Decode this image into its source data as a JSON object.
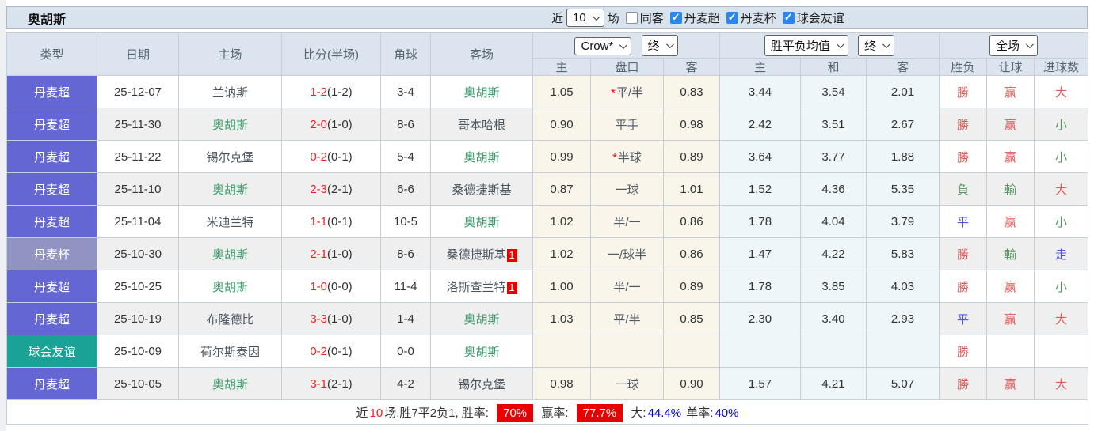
{
  "title": "奥胡斯",
  "controls": {
    "recent_label": "近",
    "match_count": "10",
    "matches_label": "场",
    "checkboxes": [
      {
        "label": "同客",
        "checked": false
      },
      {
        "label": "丹麦超",
        "checked": true
      },
      {
        "label": "丹麦杯",
        "checked": true
      },
      {
        "label": "球会友谊",
        "checked": true
      }
    ]
  },
  "header": {
    "left_cols": [
      "类型",
      "日期",
      "主场",
      "比分(半场)",
      "角球",
      "客场"
    ],
    "odds_provider_select": "Crow*",
    "odds_final_select": "终",
    "europe_select": "胜平负均值",
    "europe_final_select": "终",
    "scope_select": "全场",
    "sub_cols": [
      "主",
      "盘口",
      "客",
      "主",
      "和",
      "客",
      "胜负",
      "让球",
      "进球数"
    ]
  },
  "rows": [
    {
      "type": "丹麦超",
      "league": "super",
      "date": "25-12-07",
      "home": "兰讷斯",
      "home_green": false,
      "home_badge": "",
      "score": "1-2",
      "half": "(1-2)",
      "corners": "3-4",
      "away": "奥胡斯",
      "away_green": true,
      "away_badge": "",
      "h1": "1.05",
      "hk": "平/半",
      "star": true,
      "h2": "0.83",
      "e1": "3.44",
      "e2": "3.54",
      "e3": "2.01",
      "r1": "勝",
      "c1": "red",
      "r2": "赢",
      "c2": "red",
      "r3": "大",
      "c3": "red"
    },
    {
      "type": "丹麦超",
      "league": "super",
      "date": "25-11-30",
      "home": "奥胡斯",
      "home_green": true,
      "home_badge": "",
      "score": "2-0",
      "half": "(1-0)",
      "corners": "8-6",
      "away": "哥本哈根",
      "away_green": false,
      "away_badge": "",
      "h1": "0.90",
      "hk": "平手",
      "star": false,
      "h2": "0.98",
      "e1": "2.42",
      "e2": "3.51",
      "e3": "2.67",
      "r1": "勝",
      "c1": "red",
      "r2": "赢",
      "c2": "red",
      "r3": "小",
      "c3": "green"
    },
    {
      "type": "丹麦超",
      "league": "super",
      "date": "25-11-22",
      "home": "锡尔克堡",
      "home_green": false,
      "home_badge": "",
      "score": "0-2",
      "half": "(0-1)",
      "corners": "5-4",
      "away": "奥胡斯",
      "away_green": true,
      "away_badge": "",
      "h1": "0.99",
      "hk": "半球",
      "star": true,
      "h2": "0.89",
      "e1": "3.64",
      "e2": "3.77",
      "e3": "1.88",
      "r1": "勝",
      "c1": "red",
      "r2": "赢",
      "c2": "red",
      "r3": "小",
      "c3": "green"
    },
    {
      "type": "丹麦超",
      "league": "super",
      "date": "25-11-10",
      "home": "奥胡斯",
      "home_green": true,
      "home_badge": "",
      "score": "2-3",
      "half": "(2-1)",
      "corners": "6-6",
      "away": "桑德捷斯基",
      "away_green": false,
      "away_badge": "",
      "h1": "0.87",
      "hk": "一球",
      "star": false,
      "h2": "1.01",
      "e1": "1.52",
      "e2": "4.36",
      "e3": "5.35",
      "r1": "負",
      "c1": "green",
      "r2": "輸",
      "c2": "green",
      "r3": "大",
      "c3": "red"
    },
    {
      "type": "丹麦超",
      "league": "super",
      "date": "25-11-04",
      "home": "米迪兰特",
      "home_green": false,
      "home_badge": "",
      "score": "1-1",
      "half": "(0-1)",
      "corners": "10-5",
      "away": "奥胡斯",
      "away_green": true,
      "away_badge": "",
      "h1": "1.02",
      "hk": "半/一",
      "star": false,
      "h2": "0.86",
      "e1": "1.78",
      "e2": "4.04",
      "e3": "3.79",
      "r1": "平",
      "c1": "blue",
      "r2": "赢",
      "c2": "red",
      "r3": "小",
      "c3": "green"
    },
    {
      "type": "丹麦杯",
      "league": "cup",
      "date": "25-10-30",
      "home": "奥胡斯",
      "home_green": true,
      "home_badge": "",
      "score": "2-1",
      "half": "(1-0)",
      "corners": "8-6",
      "away": "桑德捷斯基",
      "away_green": false,
      "away_badge": "1",
      "h1": "1.02",
      "hk": "一/球半",
      "star": false,
      "h2": "0.86",
      "e1": "1.47",
      "e2": "4.22",
      "e3": "5.83",
      "r1": "勝",
      "c1": "red",
      "r2": "輸",
      "c2": "green",
      "r3": "走",
      "c3": "blue"
    },
    {
      "type": "丹麦超",
      "league": "super",
      "date": "25-10-25",
      "home": "奥胡斯",
      "home_green": true,
      "home_badge": "",
      "score": "1-0",
      "half": "(0-0)",
      "corners": "11-4",
      "away": "洛斯查兰特",
      "away_green": false,
      "away_badge": "1",
      "h1": "1.00",
      "hk": "半/一",
      "star": false,
      "h2": "0.89",
      "e1": "1.78",
      "e2": "3.85",
      "e3": "4.03",
      "r1": "勝",
      "c1": "red",
      "r2": "赢",
      "c2": "red",
      "r3": "小",
      "c3": "green"
    },
    {
      "type": "丹麦超",
      "league": "super",
      "date": "25-10-19",
      "home": "布隆德比",
      "home_green": false,
      "home_badge": "",
      "score": "3-3",
      "half": "(1-0)",
      "corners": "1-4",
      "away": "奥胡斯",
      "away_green": true,
      "away_badge": "",
      "h1": "1.03",
      "hk": "平/半",
      "star": false,
      "h2": "0.85",
      "e1": "2.30",
      "e2": "3.40",
      "e3": "2.93",
      "r1": "平",
      "c1": "blue",
      "r2": "赢",
      "c2": "red",
      "r3": "大",
      "c3": "red"
    },
    {
      "type": "球会友谊",
      "league": "friendly",
      "date": "25-10-09",
      "home": "荷尔斯泰因",
      "home_green": false,
      "home_badge": "",
      "score": "0-2",
      "half": "(0-1)",
      "corners": "0-0",
      "away": "奥胡斯",
      "away_green": true,
      "away_badge": "",
      "h1": "",
      "hk": "",
      "star": false,
      "h2": "",
      "e1": "",
      "e2": "",
      "e3": "",
      "r1": "勝",
      "c1": "red",
      "r2": "",
      "c2": "",
      "r3": "",
      "c3": ""
    },
    {
      "type": "丹麦超",
      "league": "super",
      "date": "25-10-05",
      "home": "奥胡斯",
      "home_green": true,
      "home_badge": "",
      "score": "3-1",
      "half": "(2-1)",
      "corners": "4-2",
      "away": "锡尔克堡",
      "away_green": false,
      "away_badge": "",
      "h1": "0.98",
      "hk": "一球",
      "star": false,
      "h2": "0.90",
      "e1": "1.57",
      "e2": "4.21",
      "e3": "5.07",
      "r1": "勝",
      "c1": "red",
      "r2": "赢",
      "c2": "red",
      "r3": "大",
      "c3": "red"
    }
  ],
  "footer": {
    "recent_label": "近",
    "recent_count": "10",
    "record_text": "场,胜7平2负1, 胜率:",
    "win_rate": "70%",
    "win_odds_label": "赢率:",
    "win_odds_rate": "77.7%",
    "big_label": "大:",
    "big_rate": "44.4%",
    "single_label": "单率:",
    "single_rate": "40%"
  },
  "colors": {
    "league_super": "#6466d4",
    "league_cup": "#9193c3",
    "league_friendly": "#19a296",
    "focus_team_green": "#3a9a68",
    "score_red": "#ee2222",
    "result_red": "#e05858",
    "result_green": "#55945c",
    "result_blue": "#5353dd",
    "handicap_col_bg": "#faf5eb",
    "europe_col_bg": "#eef6fa",
    "header_bg": "#dce5ef",
    "badge_red": "#e60000",
    "rate_blue": "#0000dd",
    "checkbox_blue": "#2b87ec"
  }
}
